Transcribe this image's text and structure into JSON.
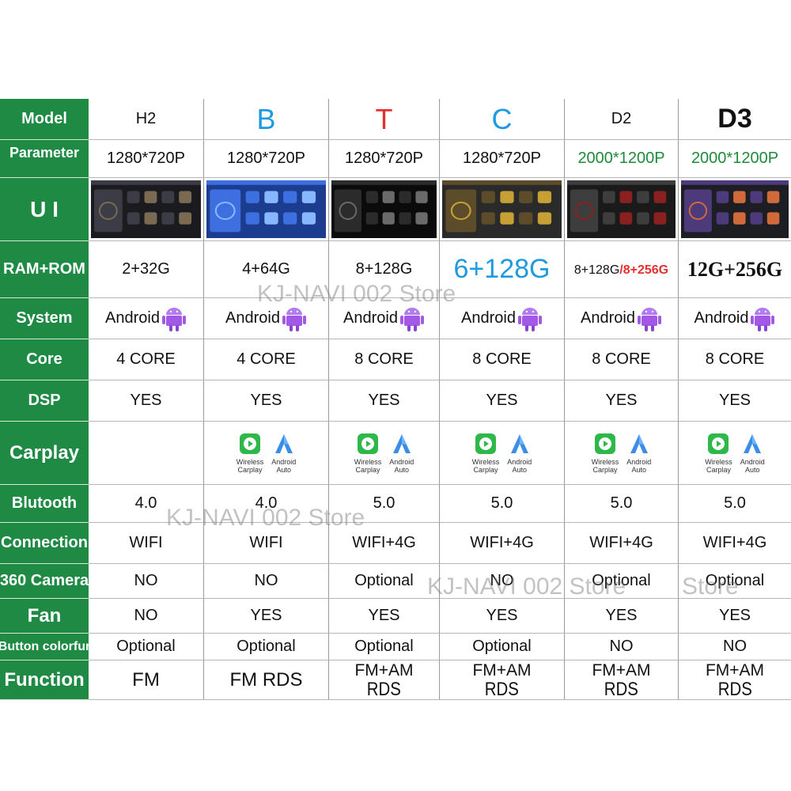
{
  "labels": [
    "Model",
    "Parameter",
    "U I",
    "RAM+ROM",
    "System",
    "Core",
    "DSP",
    "Carplay",
    "Blutooth",
    "Connection",
    "360 Camera",
    "Fan",
    "Button colorfur",
    "Function"
  ],
  "models": [
    {
      "name": "H2",
      "color": "#111111",
      "weight": "normal",
      "resolution": "1280*720P",
      "res_color": "#111111",
      "ram": "2+32G",
      "system": "Android",
      "core": "4 CORE",
      "dsp": "YES",
      "carplay": false,
      "bluetooth": "4.0",
      "connection": "WIFI",
      "camera": "NO",
      "fan": "NO",
      "button": "Optional",
      "function": [
        "FM"
      ]
    },
    {
      "name": "B",
      "color": "#1e9be0",
      "weight": "normal",
      "resolution": "1280*720P",
      "res_color": "#111111",
      "ram": "4+64G",
      "system": "Android",
      "core": "4 CORE",
      "dsp": "YES",
      "carplay": true,
      "bluetooth": "4.0",
      "connection": "WIFI",
      "camera": "NO",
      "fan": "YES",
      "button": "Optional",
      "function": [
        "FM RDS"
      ]
    },
    {
      "name": "T",
      "color": "#e53030",
      "weight": "normal",
      "resolution": "1280*720P",
      "res_color": "#111111",
      "ram": "8+128G",
      "system": "Android",
      "core": "8 CORE",
      "dsp": "YES",
      "carplay": true,
      "bluetooth": "5.0",
      "connection": "WIFI+4G",
      "camera": "Optional",
      "fan": "YES",
      "button": "Optional",
      "function": [
        "FM+AM",
        "RDS"
      ]
    },
    {
      "name": "C",
      "color": "#1e9be0",
      "weight": "normal",
      "resolution": "1280*720P",
      "res_color": "#111111",
      "ram": "6+128G",
      "ram_color": "#1e9be0",
      "system": "Android",
      "core": "8 CORE",
      "dsp": "YES",
      "carplay": true,
      "bluetooth": "5.0",
      "connection": "WIFI+4G",
      "camera": "NO",
      "fan": "YES",
      "button": "Optional",
      "function": [
        "FM+AM",
        "RDS"
      ]
    },
    {
      "name": "D2",
      "color": "#111111",
      "weight": "normal",
      "resolution": "2000*1200P",
      "res_color": "#1f8a3a",
      "ram": "8+128G",
      "ram_extra": "/8+256G",
      "system": "Android",
      "core": "8 CORE",
      "dsp": "YES",
      "carplay": true,
      "bluetooth": "5.0",
      "connection": "WIFI+4G",
      "camera": "Optional",
      "fan": "YES",
      "button": "NO",
      "function": [
        "FM+AM",
        "RDS"
      ]
    },
    {
      "name": "D3",
      "color": "#111111",
      "weight": "bold",
      "resolution": "2000*1200P",
      "res_color": "#1f8a3a",
      "ram": "12G+256G",
      "system": "Android",
      "core": "8 CORE",
      "dsp": "YES",
      "carplay": true,
      "bluetooth": "5.0",
      "connection": "WIFI+4G",
      "camera": "Optional",
      "fan": "YES",
      "button": "NO",
      "function": [
        "FM+AM",
        "RDS"
      ]
    }
  ],
  "carplay_labels": {
    "left": [
      "Wireless",
      "Carplay"
    ],
    "right": [
      "Android",
      "Auto"
    ]
  },
  "watermarks": [
    "KJ-NAVI 002 Store",
    "KJ-NAVI 002 Store",
    "KJ-NAVI 002 Store",
    "Store"
  ],
  "colors": {
    "label_bg": "#1e8a44",
    "red_text": "#e53030",
    "blue_text": "#1e9be0",
    "green_text": "#1f8a3a",
    "android": "#a259e6"
  }
}
